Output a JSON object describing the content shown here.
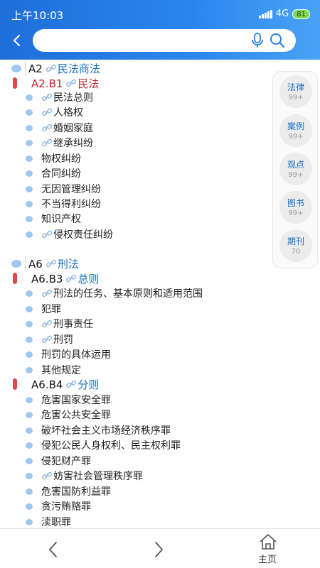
{
  "status": {
    "time": "上午10:03",
    "network": "4G",
    "battery": "81"
  },
  "search": {
    "placeholder": "",
    "value": ""
  },
  "tree": {
    "sections": [
      {
        "code": "A2",
        "title": "民法商法",
        "groups": [
          {
            "code": "A2.B1",
            "title": "民法",
            "items": [
              {
                "label": "民法总则",
                "linked": true
              },
              {
                "label": "人格权",
                "linked": true
              },
              {
                "label": "婚姻家庭",
                "linked": true
              },
              {
                "label": "继承纠纷",
                "linked": true
              },
              {
                "label": "物权纠纷",
                "linked": false
              },
              {
                "label": "合同纠纷",
                "linked": false
              },
              {
                "label": "无因管理纠纷",
                "linked": false
              },
              {
                "label": "不当得利纠纷",
                "linked": false
              },
              {
                "label": "知识产权",
                "linked": false
              },
              {
                "label": "侵权责任纠纷",
                "linked": true
              }
            ]
          }
        ]
      },
      {
        "code": "A6",
        "title": "刑法",
        "groups": [
          {
            "code": "A6.B3",
            "title": "总则",
            "items": [
              {
                "label": "刑法的任务、基本原则和适用范围",
                "linked": true
              },
              {
                "label": "犯罪",
                "linked": false
              },
              {
                "label": "刑事责任",
                "linked": true
              },
              {
                "label": "刑罚",
                "linked": true
              },
              {
                "label": "刑罚的具体运用",
                "linked": false
              },
              {
                "label": "其他规定",
                "linked": false
              }
            ]
          },
          {
            "code": "A6.B4",
            "title": "分则",
            "items": [
              {
                "label": "危害国家安全罪",
                "linked": false
              },
              {
                "label": "危害公共安全罪",
                "linked": false
              },
              {
                "label": "破坏社会主义市场经济秩序罪",
                "linked": false
              },
              {
                "label": "侵犯公民人身权利、民主权利罪",
                "linked": false
              },
              {
                "label": "侵犯财产罪",
                "linked": false
              },
              {
                "label": "妨害社会管理秩序罪",
                "linked": true
              },
              {
                "label": "危害国防利益罪",
                "linked": false
              },
              {
                "label": "贪污贿赂罪",
                "linked": false
              },
              {
                "label": "渎职罪",
                "linked": false
              }
            ]
          }
        ]
      }
    ]
  },
  "side_panel": [
    {
      "label": "法律",
      "count": "99+"
    },
    {
      "label": "案例",
      "count": "99+"
    },
    {
      "label": "观点",
      "count": "99+"
    },
    {
      "label": "图书",
      "count": "99+"
    },
    {
      "label": "期刊",
      "count": "70"
    }
  ],
  "bottom_nav": {
    "home_label": "主页"
  },
  "icons": {
    "back": "chevron-left-icon",
    "mic": "microphone-icon",
    "search": "search-icon",
    "link": "link-icon",
    "prev": "chevron-left-icon",
    "next": "chevron-right-icon",
    "home": "home-icon"
  },
  "colors": {
    "header_blue": "#2a86ee",
    "link_blue": "#1a6fbf",
    "level2_red": "#d94a4a",
    "bullet_blue": "#9fc7ef",
    "battery_green": "#7ed957"
  }
}
